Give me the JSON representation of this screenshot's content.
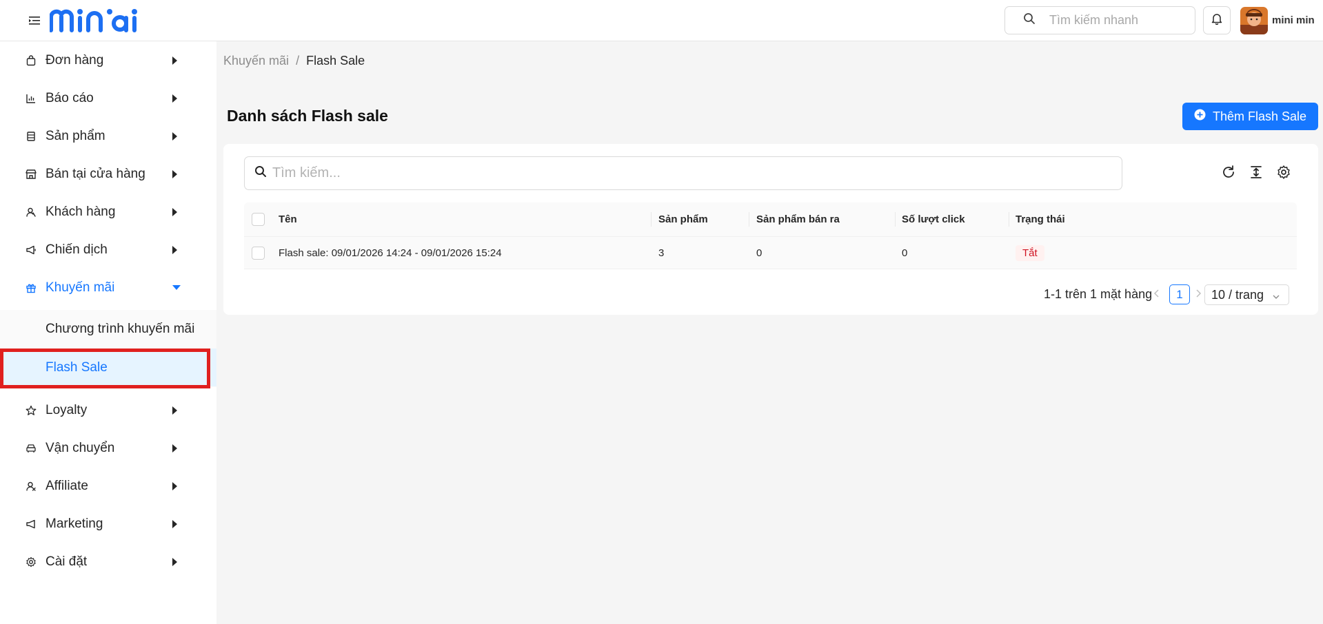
{
  "header": {
    "logo_text": "miniai",
    "search_placeholder": "Tìm kiếm nhanh",
    "username": "mini min"
  },
  "sidebar": {
    "items": [
      {
        "label": "Đơn hàng",
        "icon": "shopping-bag-icon"
      },
      {
        "label": "Báo cáo",
        "icon": "bar-chart-icon"
      },
      {
        "label": "Sản phẩm",
        "icon": "product-list-icon"
      },
      {
        "label": "Bán tại cửa hàng",
        "icon": "store-icon"
      },
      {
        "label": "Khách hàng",
        "icon": "customer-icon"
      },
      {
        "label": "Chiến dịch",
        "icon": "megaphone-icon"
      },
      {
        "label": "Khuyến mãi",
        "icon": "gift-icon"
      },
      {
        "label": "Loyalty",
        "icon": "star-icon"
      },
      {
        "label": "Vận chuyển",
        "icon": "car-icon"
      },
      {
        "label": "Affiliate",
        "icon": "affiliate-icon"
      },
      {
        "label": "Marketing",
        "icon": "marketing-icon"
      },
      {
        "label": "Cài đặt",
        "icon": "gear-icon"
      }
    ],
    "sub_items": [
      {
        "label": "Chương trình khuyến mãi"
      },
      {
        "label": "Flash Sale"
      }
    ]
  },
  "breadcrumb": {
    "parent": "Khuyến mãi",
    "separator": "/",
    "current": "Flash Sale"
  },
  "page": {
    "title": "Danh sách Flash sale",
    "add_button": "Thêm Flash Sale",
    "search_placeholder": "Tìm kiếm..."
  },
  "table": {
    "columns": [
      "Tên",
      "Sản phẩm",
      "Sản phẩm bán ra",
      "Số lượt click",
      "Trạng thái"
    ],
    "rows": [
      {
        "name": "Flash sale: 09/01/2026 14:24 - 09/01/2026 15:24",
        "products": "3",
        "sold": "0",
        "clicks": "0",
        "status": "Tắt"
      }
    ]
  },
  "pagination": {
    "total_text": "1-1 trên 1 mặt hàng",
    "current_page": "1",
    "page_size": "10 / trang"
  },
  "colors": {
    "accent": "#1677ff",
    "annotation_red": "#e0201f",
    "status_off": "#cf1322"
  }
}
